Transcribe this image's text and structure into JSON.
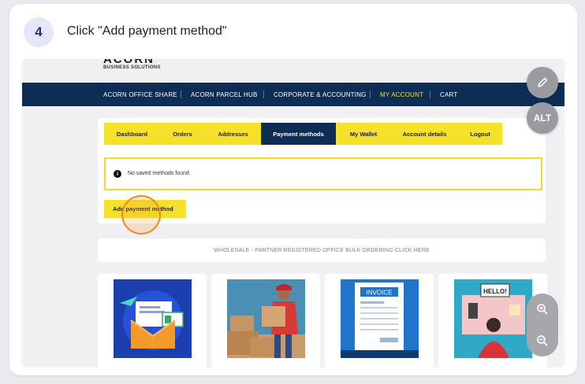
{
  "step": {
    "number": "4",
    "instruction": "Click \"Add payment method\""
  },
  "site": {
    "logo_main": "ACORN",
    "logo_sub": "BUSINESS SOLUTIONS",
    "nav": [
      {
        "label": "ACORN OFFICE SHARE"
      },
      {
        "label": "ACORN PARCEL HUB"
      },
      {
        "label": "CORPORATE & ACCOUNTING"
      },
      {
        "label": "MY ACCOUNT"
      },
      {
        "label": "CART"
      }
    ]
  },
  "account": {
    "tabs": [
      {
        "label": "Dashboard"
      },
      {
        "label": "Orders"
      },
      {
        "label": "Addresses"
      },
      {
        "label": "Payment methods"
      },
      {
        "label": "My Wallet"
      },
      {
        "label": "Account details"
      },
      {
        "label": "Logout"
      }
    ],
    "active_tab": "Payment methods",
    "notice": "No saved methods found.",
    "add_button": "Add payment method"
  },
  "wholesale_link": "WHOLESALE - PARTNER REGISTERED OFFICE BULK ORDERING CLICK HERE",
  "products": [
    {
      "icon": "mail-envelope-image"
    },
    {
      "icon": "parcel-delivery-image"
    },
    {
      "icon": "invoice-image",
      "label": "INVOICE"
    },
    {
      "icon": "hello-desk-image",
      "label": "HELLO!"
    }
  ],
  "controls": {
    "alt_label": "ALT"
  },
  "colors": {
    "navy": "#0d2d55",
    "yellow": "#f5e02a",
    "accent_orange": "#f08a1d",
    "nav_active": "#f5e02a"
  }
}
